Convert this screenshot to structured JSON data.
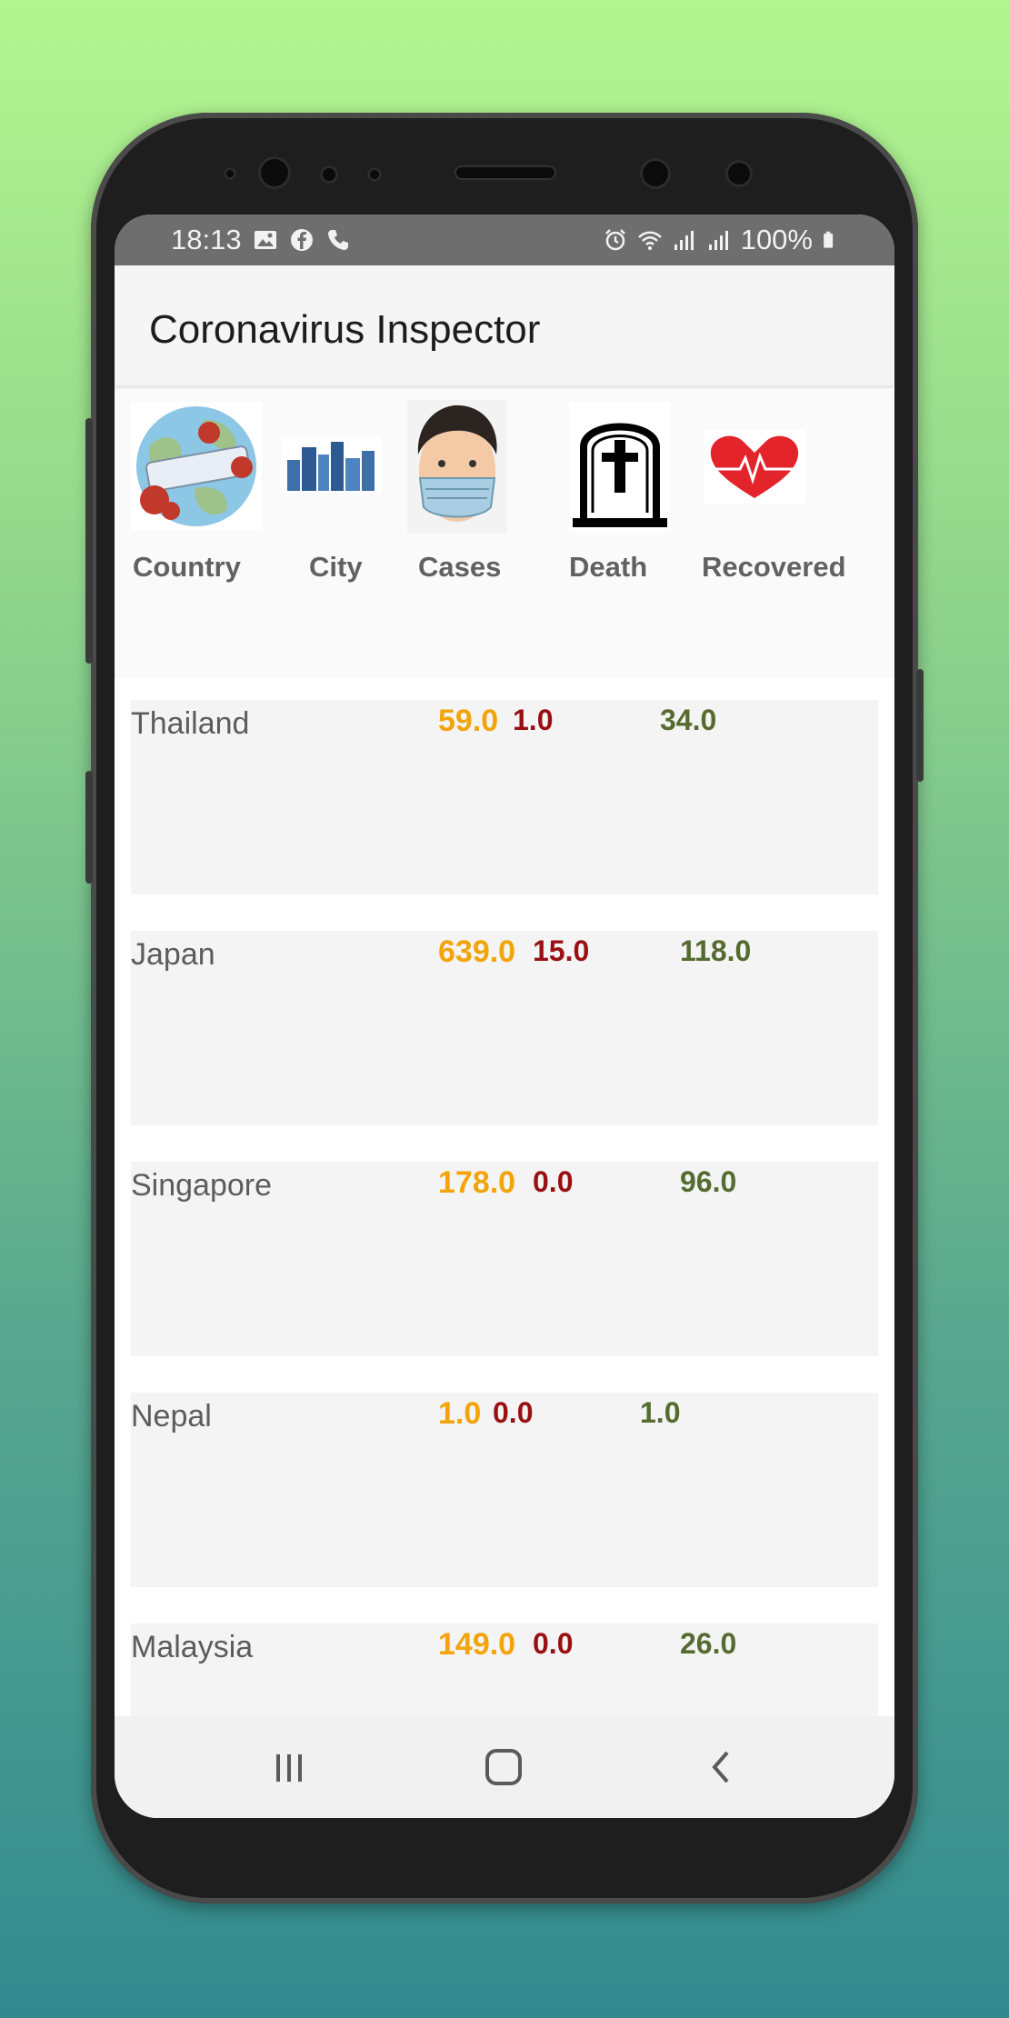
{
  "status_bar": {
    "time": "18:13",
    "battery": "100%",
    "left_icons": [
      "image-icon",
      "facebook-icon",
      "phone-icon"
    ],
    "right_icons": [
      "alarm-icon",
      "wifi-icon",
      "signal-icon",
      "signal-icon",
      "battery-icon"
    ]
  },
  "app": {
    "title": "Coronavirus Inspector"
  },
  "columns": {
    "country": "Country",
    "city": "City",
    "cases": "Cases",
    "death": "Death",
    "recovered": "Recovered"
  },
  "rows": [
    {
      "country": "Thailand",
      "cases": "59.0",
      "death": "1.0",
      "recovered": "34.0"
    },
    {
      "country": "Japan",
      "cases": "639.0",
      "death": "15.0",
      "recovered": "118.0"
    },
    {
      "country": "Singapore",
      "cases": "178.0",
      "death": "0.0",
      "recovered": "96.0"
    },
    {
      "country": "Nepal",
      "cases": "1.0",
      "death": "0.0",
      "recovered": "1.0"
    },
    {
      "country": "Malaysia",
      "cases": "149.0",
      "death": "0.0",
      "recovered": "26.0"
    }
  ],
  "colors": {
    "cases": "#f3a40b",
    "death": "#9a0f14",
    "recovered": "#556b2f"
  },
  "nav": [
    "recents-icon",
    "home-icon",
    "back-icon"
  ]
}
